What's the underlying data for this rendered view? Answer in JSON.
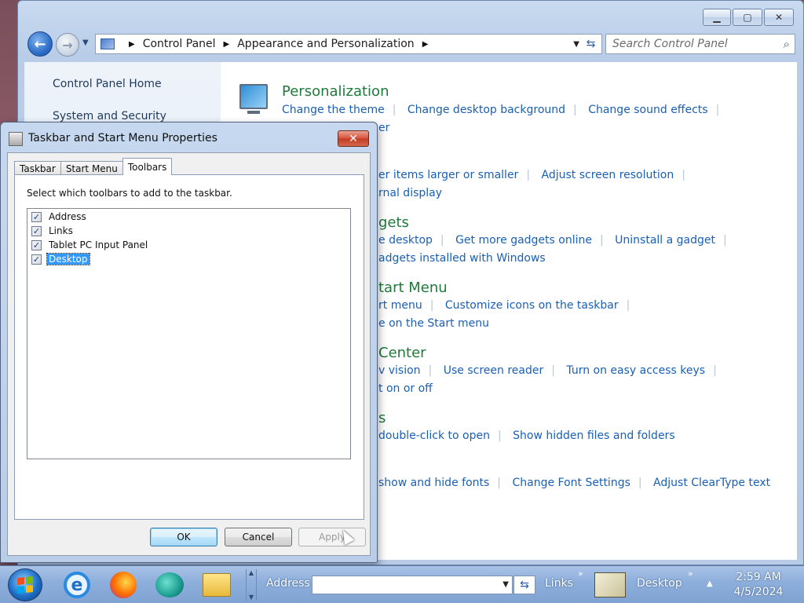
{
  "explorer": {
    "breadcrumb": [
      "Control Panel",
      "Appearance and Personalization"
    ],
    "search_placeholder": "Search Control Panel",
    "left_links": [
      "Control Panel Home",
      "System and Security"
    ],
    "sections": [
      {
        "heading": "Personalization",
        "links_line1": [
          "Change the theme",
          "Change desktop background",
          "Change sound effects"
        ],
        "links_line2": [
          "er"
        ]
      },
      {
        "heading": "",
        "links_line1": [
          "er items larger or smaller",
          "Adjust screen resolution"
        ],
        "links_line2": [
          "rnal display"
        ]
      },
      {
        "heading": "gets",
        "links_line1": [
          "e desktop",
          "Get more gadgets online",
          "Uninstall a gadget"
        ],
        "links_line2": [
          "adgets installed with Windows"
        ]
      },
      {
        "heading": "tart Menu",
        "links_line1": [
          "rt menu",
          "Customize icons on the taskbar"
        ],
        "links_line2": [
          "e on the Start menu"
        ]
      },
      {
        "heading": "Center",
        "links_line1": [
          "v vision",
          "Use screen reader",
          "Turn on easy access keys"
        ],
        "links_line2": [
          "t on or off"
        ]
      },
      {
        "heading": "s",
        "links_line1": [
          "double-click to open",
          "Show hidden files and folders"
        ],
        "links_line2": []
      },
      {
        "heading": "",
        "links_line1": [
          "show and hide fonts",
          "Change Font Settings",
          "Adjust ClearType text"
        ],
        "links_line2": []
      }
    ]
  },
  "dialog": {
    "title": "Taskbar and Start Menu Properties",
    "tabs": [
      "Taskbar",
      "Start Menu",
      "Toolbars"
    ],
    "active_tab": "Toolbars",
    "instruction": "Select which toolbars to add to the taskbar.",
    "toolbars": [
      {
        "label": "Address",
        "checked": true
      },
      {
        "label": "Links",
        "checked": true
      },
      {
        "label": "Tablet PC Input Panel",
        "checked": true
      },
      {
        "label": "Desktop",
        "checked": true,
        "selected": true
      }
    ],
    "buttons": {
      "ok": "OK",
      "cancel": "Cancel",
      "apply": "Apply"
    }
  },
  "taskbar": {
    "address_label": "Address",
    "links_label": "Links",
    "desktop_label": "Desktop",
    "clock_time": "2:59 AM",
    "clock_date": "4/5/2024"
  },
  "icons": {
    "back": "back-arrow-icon",
    "forward": "forward-arrow-icon",
    "refresh": "refresh-icon",
    "search": "search-icon",
    "close": "close-icon"
  }
}
